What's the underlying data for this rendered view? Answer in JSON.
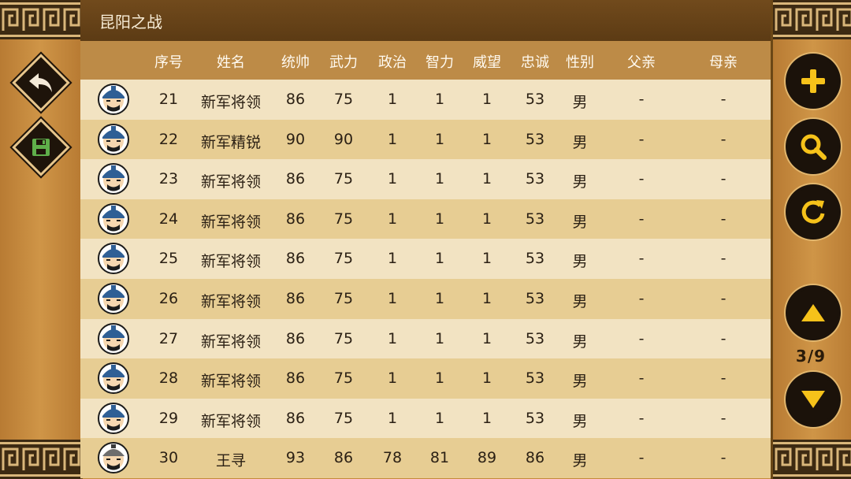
{
  "title": "昆阳之战",
  "headers": {
    "index": "序号",
    "name": "姓名",
    "lead": "统帅",
    "force": "武力",
    "politics": "政治",
    "intel": "智力",
    "prestige": "威望",
    "loyalty": "忠诚",
    "gender": "性别",
    "father": "父亲",
    "mother": "母亲"
  },
  "rows": [
    {
      "index": "21",
      "name": "新军将领",
      "lead": "86",
      "force": "75",
      "politics": "1",
      "intel": "1",
      "prestige": "1",
      "loyalty": "53",
      "gender": "男",
      "father": "-",
      "mother": "-"
    },
    {
      "index": "22",
      "name": "新军精锐",
      "lead": "90",
      "force": "90",
      "politics": "1",
      "intel": "1",
      "prestige": "1",
      "loyalty": "53",
      "gender": "男",
      "father": "-",
      "mother": "-"
    },
    {
      "index": "23",
      "name": "新军将领",
      "lead": "86",
      "force": "75",
      "politics": "1",
      "intel": "1",
      "prestige": "1",
      "loyalty": "53",
      "gender": "男",
      "father": "-",
      "mother": "-"
    },
    {
      "index": "24",
      "name": "新军将领",
      "lead": "86",
      "force": "75",
      "politics": "1",
      "intel": "1",
      "prestige": "1",
      "loyalty": "53",
      "gender": "男",
      "father": "-",
      "mother": "-"
    },
    {
      "index": "25",
      "name": "新军将领",
      "lead": "86",
      "force": "75",
      "politics": "1",
      "intel": "1",
      "prestige": "1",
      "loyalty": "53",
      "gender": "男",
      "father": "-",
      "mother": "-"
    },
    {
      "index": "26",
      "name": "新军将领",
      "lead": "86",
      "force": "75",
      "politics": "1",
      "intel": "1",
      "prestige": "1",
      "loyalty": "53",
      "gender": "男",
      "father": "-",
      "mother": "-"
    },
    {
      "index": "27",
      "name": "新军将领",
      "lead": "86",
      "force": "75",
      "politics": "1",
      "intel": "1",
      "prestige": "1",
      "loyalty": "53",
      "gender": "男",
      "father": "-",
      "mother": "-"
    },
    {
      "index": "28",
      "name": "新军将领",
      "lead": "86",
      "force": "75",
      "politics": "1",
      "intel": "1",
      "prestige": "1",
      "loyalty": "53",
      "gender": "男",
      "father": "-",
      "mother": "-"
    },
    {
      "index": "29",
      "name": "新军将领",
      "lead": "86",
      "force": "75",
      "politics": "1",
      "intel": "1",
      "prestige": "1",
      "loyalty": "53",
      "gender": "男",
      "father": "-",
      "mother": "-"
    },
    {
      "index": "30",
      "name": "王寻",
      "lead": "93",
      "force": "86",
      "politics": "78",
      "intel": "81",
      "prestige": "89",
      "loyalty": "86",
      "gender": "男",
      "father": "-",
      "mother": "-"
    }
  ],
  "pagination": {
    "text": "3/9"
  },
  "icons": {
    "back": "back-arrow-icon",
    "save": "save-icon",
    "add": "plus-icon",
    "search": "search-icon",
    "refresh": "refresh-icon",
    "page_up": "triangle-up-icon",
    "page_down": "triangle-down-icon"
  },
  "colors": {
    "title_bar": "#5c3b14",
    "header": "#bd8b47",
    "row_light": "#f2e3c2",
    "row_dark": "#e7cd93",
    "frame": "#c58a3c",
    "save_green": "#5fae4a",
    "button_yellow": "#f6c21a"
  }
}
